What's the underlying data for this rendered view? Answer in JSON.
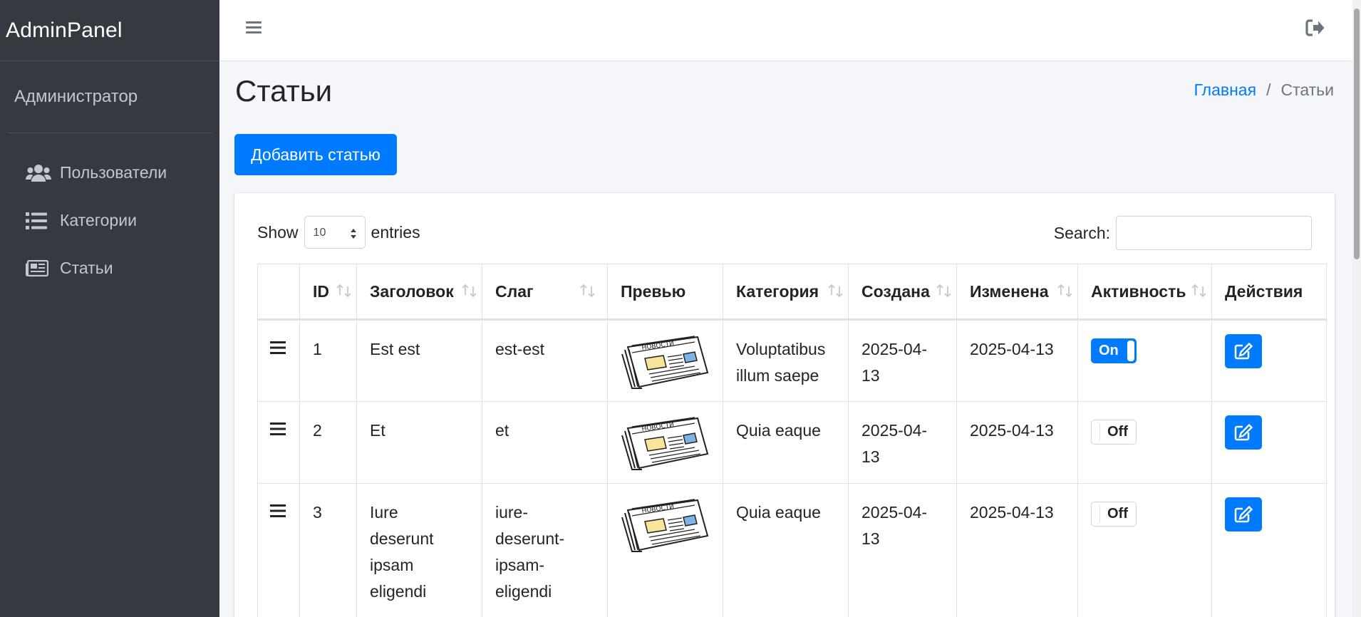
{
  "brand": "AdminPanel",
  "user": "Администратор",
  "sidebar": {
    "items": [
      {
        "label": "Пользователи",
        "icon": "users-icon"
      },
      {
        "label": "Категории",
        "icon": "list-icon"
      },
      {
        "label": "Статьи",
        "icon": "newspaper-icon"
      }
    ]
  },
  "page": {
    "title": "Статьи",
    "breadcrumb": {
      "home": "Главная",
      "separator": "/",
      "current": "Статьи"
    },
    "add_button": "Добавить статью"
  },
  "table_controls": {
    "show_label": "Show",
    "entries_label": "entries",
    "page_size": "10",
    "search_label": "Search:",
    "search_value": ""
  },
  "table": {
    "columns": [
      "",
      "ID",
      "Заголовок",
      "Слаг",
      "Превью",
      "Категория",
      "Создана",
      "Изменена",
      "Активность",
      "Действия"
    ],
    "rows": [
      {
        "id": "1",
        "title": "Est est",
        "slug": "est-est",
        "preview_text": "НОВОСТИ",
        "category": "Voluptatibus illum saepe",
        "created": "2025-04-13",
        "updated": "2025-04-13",
        "active": true,
        "active_label": "On"
      },
      {
        "id": "2",
        "title": "Et",
        "slug": "et",
        "preview_text": "НОВОСТИ",
        "category": "Quia eaque",
        "created": "2025-04-13",
        "updated": "2025-04-13",
        "active": false,
        "active_label": "Off"
      },
      {
        "id": "3",
        "title": "Iure deserunt ipsam eligendi",
        "slug": "iure-deserunt-ipsam-eligendi",
        "preview_text": "НОВОСТИ",
        "category": "Quia eaque",
        "created": "2025-04-13",
        "updated": "2025-04-13",
        "active": false,
        "active_label": "Off"
      }
    ]
  },
  "colors": {
    "sidebar_bg": "#343a40",
    "primary": "#007bff",
    "content_bg": "#f4f6f9"
  }
}
